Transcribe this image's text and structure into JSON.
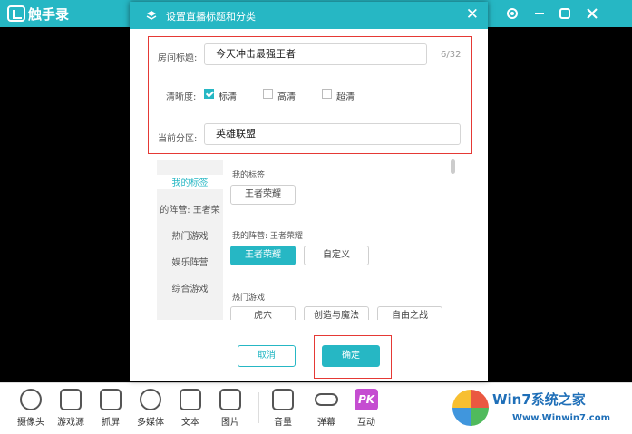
{
  "app": {
    "name": "触手录"
  },
  "dialog": {
    "title": "设置直播标题和分类",
    "room_title_label": "房间标题:",
    "room_title_value": "今天冲击最强王者",
    "room_title_counter": "6/32",
    "quality_label": "清晰度:",
    "quality_options": [
      "标清",
      "高清",
      "超清"
    ],
    "quality_selected": "标清",
    "category_label": "当前分区:",
    "category_value": "英雄联盟",
    "sidebar": [
      "我的标签",
      "的阵营: 王者荣",
      "热门游戏",
      "娱乐阵营",
      "综合游戏"
    ],
    "sections": {
      "my_tags_title": "我的标签",
      "my_tags": [
        "王者荣耀"
      ],
      "camp_title": "我的阵营: 王者荣耀",
      "camp_tags": [
        "王者荣耀",
        "自定义"
      ],
      "hot_title": "热门游戏",
      "hot_tags": [
        "虎穴",
        "创造与魔法",
        "自由之战"
      ]
    },
    "cancel_label": "取消",
    "ok_label": "确定"
  },
  "toolbar": [
    "摄像头",
    "游戏源",
    "抓屏",
    "多媒体",
    "文本",
    "图片",
    "音量",
    "弹幕",
    "互动"
  ],
  "toolbar_pk_badge": "PK",
  "watermark": {
    "title": "Win7系统之家",
    "url": "Www.Winwin7.com"
  },
  "colors": {
    "accent": "#26b7c4",
    "highlight": "#e53935"
  }
}
